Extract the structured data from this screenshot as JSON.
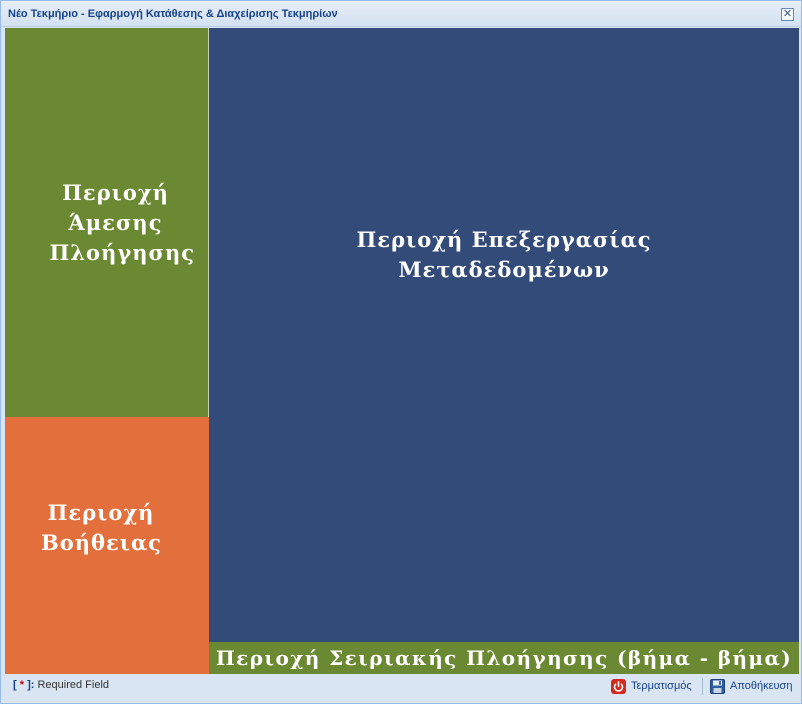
{
  "window": {
    "title": "Νέο Τεκμήριο - Εφαρμογή Κατάθεσης & Διαχείρισης Τεκμηρίων",
    "close_glyph": "✕"
  },
  "regions": {
    "direct_nav": {
      "label": "Περιοχή Άμεσης Πλοήγησης",
      "color": "#6b8833"
    },
    "help": {
      "label": "Περιοχή Βοήθειας",
      "color": "#e3703c"
    },
    "metadata": {
      "label": "Περιοχή Επεξεργασίας Μεταδεδομένων",
      "color": "#334b78"
    },
    "serial_nav": {
      "label": "Περιοχή Σειριακής Πλοήγησης (βήμα - βήμα)",
      "color": "#6b8833"
    }
  },
  "footer": {
    "required_open": "[ ",
    "required_star": "*",
    "required_close": " ]:",
    "required_text": " Required Field",
    "terminate_label": "Τερματισμός",
    "terminate_icon": "power-icon",
    "save_label": "Αποθήκευση",
    "save_icon": "floppy-disk-icon"
  }
}
